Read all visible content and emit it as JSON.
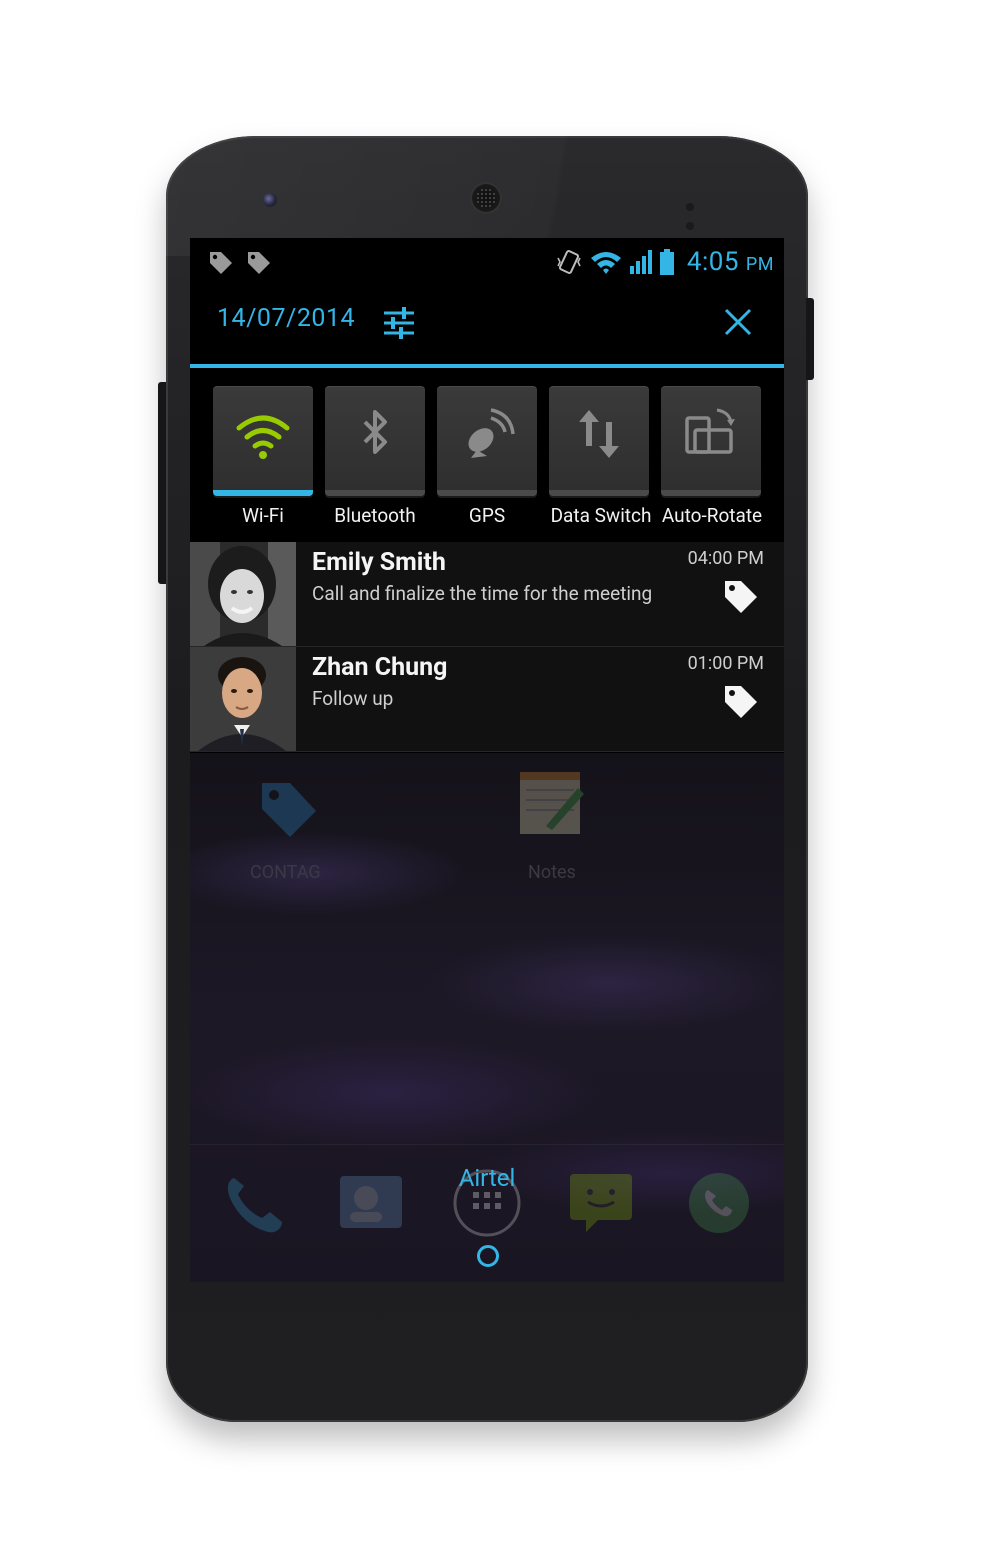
{
  "status_bar": {
    "time": "4:05",
    "ampm": "PM",
    "icons": [
      "tag-icon",
      "tag-icon",
      "vibrate-icon",
      "wifi-icon",
      "signal-icon",
      "battery-icon"
    ]
  },
  "header": {
    "date": "14/07/2014"
  },
  "quick_settings": [
    {
      "label": "Wi-Fi",
      "icon": "wifi-icon",
      "active": true
    },
    {
      "label": "Bluetooth",
      "icon": "bluetooth-icon",
      "active": false
    },
    {
      "label": "GPS",
      "icon": "gps-icon",
      "active": false
    },
    {
      "label": "Data Switch",
      "icon": "data-switch-icon",
      "active": false
    },
    {
      "label": "Auto-Rotate",
      "icon": "auto-rotate-icon",
      "active": false
    }
  ],
  "notifications": [
    {
      "name": "Emily Smith",
      "message": "Call and finalize the time for the meeting",
      "time": "04:00 PM"
    },
    {
      "name": "Zhan Chung",
      "message": "Follow up",
      "time": "01:00 PM"
    }
  ],
  "home": {
    "apps": [
      "CONTAG",
      "Notes"
    ],
    "carrier": "Airtel"
  },
  "colors": {
    "accent": "#33b5e5",
    "wifi_active": "#99cc00",
    "notification_bg": "#111111"
  }
}
